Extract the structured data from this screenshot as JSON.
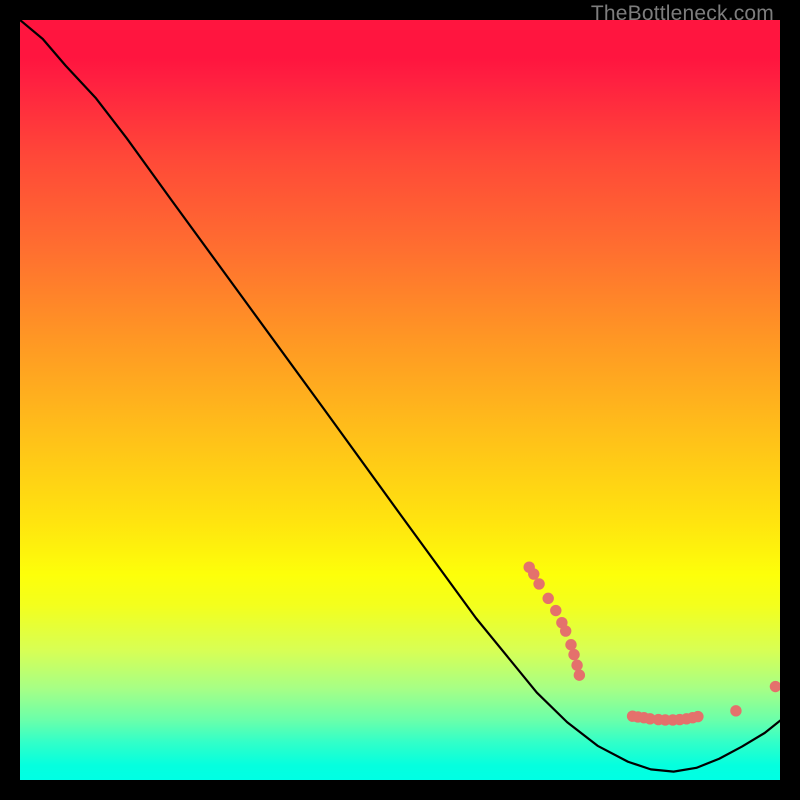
{
  "watermark": "TheBottleneck.com",
  "chart_data": {
    "type": "line",
    "title": "",
    "xlabel": "",
    "ylabel": "",
    "xlim": [
      0,
      100
    ],
    "ylim": [
      0,
      100
    ],
    "curve": [
      {
        "x": 0,
        "y": 100
      },
      {
        "x": 3,
        "y": 97.5
      },
      {
        "x": 6,
        "y": 94
      },
      {
        "x": 10,
        "y": 89.7
      },
      {
        "x": 14,
        "y": 84.5
      },
      {
        "x": 20,
        "y": 76.2
      },
      {
        "x": 30,
        "y": 62.5
      },
      {
        "x": 40,
        "y": 48.8
      },
      {
        "x": 50,
        "y": 35
      },
      {
        "x": 60,
        "y": 21.3
      },
      {
        "x": 68,
        "y": 11.5
      },
      {
        "x": 72,
        "y": 7.6
      },
      {
        "x": 76,
        "y": 4.5
      },
      {
        "x": 80,
        "y": 2.4
      },
      {
        "x": 83,
        "y": 1.4
      },
      {
        "x": 86,
        "y": 1.1
      },
      {
        "x": 89,
        "y": 1.6
      },
      {
        "x": 92,
        "y": 2.8
      },
      {
        "x": 95,
        "y": 4.4
      },
      {
        "x": 98,
        "y": 6.2
      },
      {
        "x": 100,
        "y": 7.8
      }
    ],
    "points_cluster_a": [
      {
        "x": 67.0,
        "y": 28.0
      },
      {
        "x": 67.6,
        "y": 27.1
      },
      {
        "x": 68.3,
        "y": 25.8
      },
      {
        "x": 69.5,
        "y": 23.9
      },
      {
        "x": 70.5,
        "y": 22.3
      },
      {
        "x": 71.3,
        "y": 20.7
      },
      {
        "x": 71.8,
        "y": 19.6
      },
      {
        "x": 72.5,
        "y": 17.8
      },
      {
        "x": 72.9,
        "y": 16.5
      },
      {
        "x": 73.3,
        "y": 15.1
      },
      {
        "x": 73.6,
        "y": 13.8
      }
    ],
    "points_cluster_b": [
      {
        "x": 80.6,
        "y": 8.4
      },
      {
        "x": 81.3,
        "y": 8.3
      },
      {
        "x": 82.1,
        "y": 8.2
      },
      {
        "x": 82.9,
        "y": 8.05
      },
      {
        "x": 84.0,
        "y": 7.95
      },
      {
        "x": 84.9,
        "y": 7.9
      },
      {
        "x": 85.9,
        "y": 7.9
      },
      {
        "x": 86.8,
        "y": 7.95
      },
      {
        "x": 87.7,
        "y": 8.05
      },
      {
        "x": 88.5,
        "y": 8.2
      },
      {
        "x": 89.2,
        "y": 8.35
      },
      {
        "x": 94.2,
        "y": 9.1
      }
    ],
    "points_outlier": [
      {
        "x": 99.4,
        "y": 12.3
      }
    ],
    "point_radius_pct": 0.75
  }
}
